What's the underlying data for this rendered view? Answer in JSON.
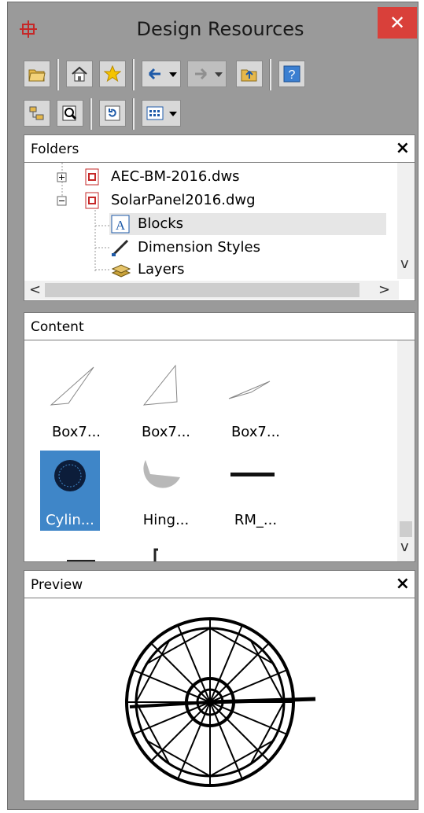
{
  "window": {
    "title": "Design Resources",
    "close_label": "✕"
  },
  "toolbar1": [
    "load-icon",
    "home-icon",
    "favorites-icon",
    "back-icon",
    "forward-icon",
    "up-icon",
    "help-icon"
  ],
  "toolbar2": [
    "tree-toggle-icon",
    "preview-toggle-icon",
    "refresh-icon",
    "views-icon"
  ],
  "folders": {
    "header": "Folders",
    "close_label": "×",
    "items": [
      {
        "label": "AEC-BM-2016.dws"
      },
      {
        "label": "SolarPanel2016.dwg"
      },
      {
        "label": "Blocks"
      },
      {
        "label": "Dimension Styles"
      },
      {
        "label": "Layers"
      }
    ],
    "scroll_left": "<",
    "scroll_right": ">",
    "scroll_down": "v"
  },
  "content": {
    "header": "Content",
    "items": [
      {
        "label": "Box7..."
      },
      {
        "label": "Box7..."
      },
      {
        "label": "Box7..."
      },
      {
        "label": "Cylin..."
      },
      {
        "label": "Hing..."
      },
      {
        "label": "RM_..."
      }
    ],
    "scroll_down": "v"
  },
  "preview": {
    "header": "Preview",
    "close_label": "×"
  },
  "colors": {
    "close": "#d9403a",
    "selection": "#3f86c8",
    "chrome": "#9a9a9a"
  }
}
